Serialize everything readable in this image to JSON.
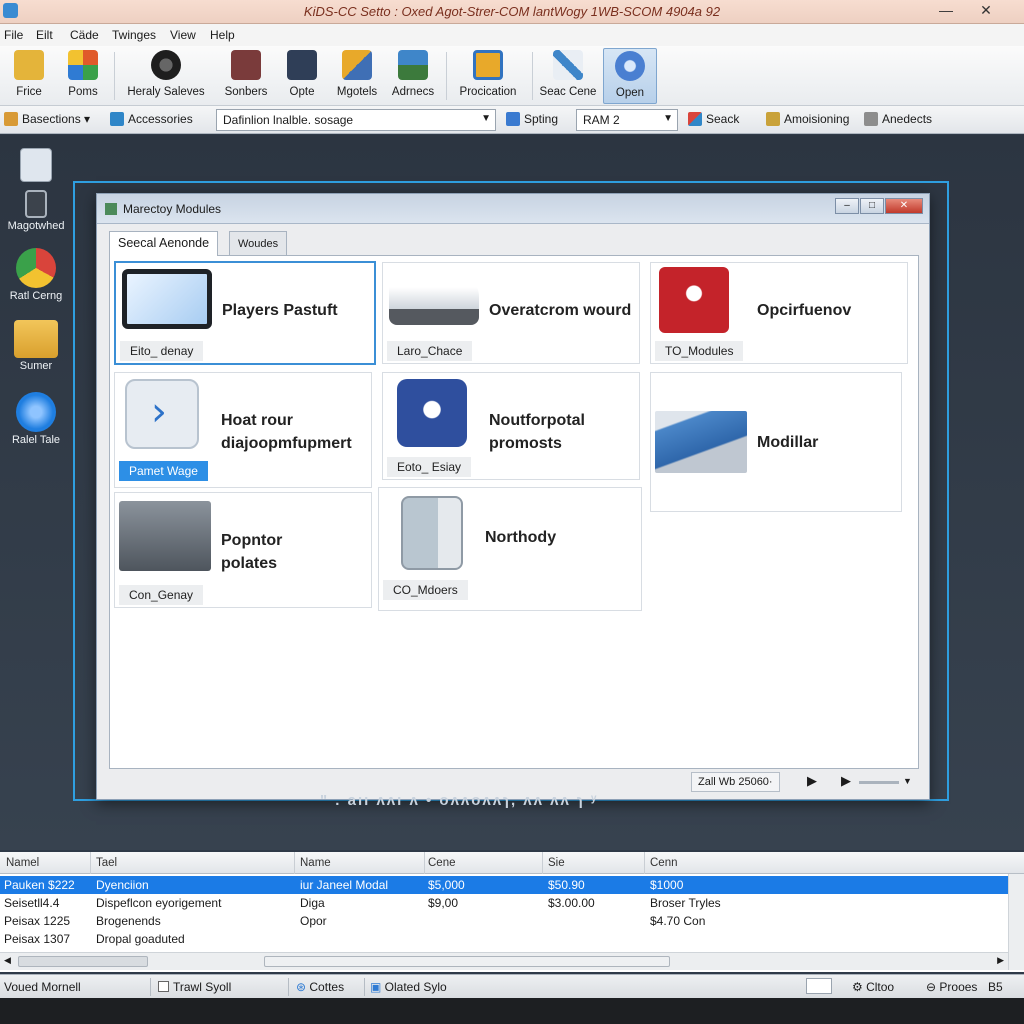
{
  "window": {
    "title": "KiDS-CC Setto : Oxed  Agot-Strer-COM  lantWogy  1WB-SCOM 4904a 92",
    "minimize": "—",
    "close": "✕"
  },
  "menu": [
    "File",
    "Eilt",
    "Cäde",
    "Twinges",
    "View",
    "Help"
  ],
  "ribbon": {
    "buttons": [
      {
        "label": "Frice",
        "icon": "folder-icon",
        "color": "#e4b43a"
      },
      {
        "label": "Poms",
        "icon": "color-palette-icon",
        "color": "#e05a2a"
      },
      {
        "label": "Heraly Saleves",
        "icon": "speaker-icon",
        "color": "#2b2b2b"
      },
      {
        "label": "Sonbers",
        "icon": "camera-icon",
        "color": "#7a3b3b"
      },
      {
        "label": "Opte",
        "icon": "monitor-icon",
        "color": "#2f3e57"
      },
      {
        "label": "Mgotels",
        "icon": "blocks-icon",
        "color": "#3f6fb5"
      },
      {
        "label": "Adrnecs",
        "icon": "gallery-icon",
        "color": "#3c7a3c"
      },
      {
        "label": "Procication",
        "icon": "document-icon",
        "color": "#e8a92a"
      },
      {
        "label": "Seac Cene",
        "icon": "search-pen-icon",
        "color": "#3f86c9"
      },
      {
        "label": "Open",
        "icon": "globe-icon",
        "color": "#4a7fd1"
      }
    ]
  },
  "toolbar2": {
    "basections": "Basections",
    "accessories": "Accessories",
    "path_combo": "Dafinlion lnalble. sosage",
    "spting": "Spting",
    "ram_combo": "RAM 2",
    "seack": "Seack",
    "amoisioning": "Amoisioning",
    "anedects": "Anedects"
  },
  "desktop": {
    "icons": [
      {
        "label": "",
        "icon": "document-window-icon",
        "color": "#dfe6ee"
      },
      {
        "label": "Magotwhed",
        "icon": "phone-icon",
        "color": "#3c434c"
      },
      {
        "label": "Ratl Cerng",
        "icon": "chrome-icon",
        "color": "#d9443b"
      },
      {
        "label": "Sumer",
        "icon": "folder-icon",
        "color": "#e9b43b"
      },
      {
        "label": "Ralel Tale",
        "icon": "bluetooth-icon",
        "color": "#1f7ee0"
      }
    ],
    "blurred_caption": "\" .  aıı ʌʌı ʌ • oʌʌoʌʌɿ,   ʌʌ  ʌʌ ɿ ʸ"
  },
  "dialog": {
    "title": "Marectoy Modules",
    "tabs": [
      "Seecal Aenonde",
      "Woudes"
    ],
    "cards": [
      {
        "name": "Players Pastuft",
        "sub": "Eito_ denay",
        "icon": "tablet-icon",
        "selected": true
      },
      {
        "name": "Overatcrom wourd",
        "sub": "Laro_Chace",
        "icon": "car-icon",
        "selected": false
      },
      {
        "name": "Opcirfuenov",
        "sub": "TO_Modules",
        "icon": "engine-badge-icon",
        "selected": false
      },
      {
        "name": "Hoat rour\ndiajoopmfupmert",
        "sub": "Pamet Wage",
        "icon": "chevron-chat-icon",
        "selected": false
      },
      {
        "name": "Noutforpotal\npromosts",
        "sub": "Eoto_ Esiay",
        "icon": "shield-lock-icon",
        "selected": false
      },
      {
        "name": "Modillar",
        "sub": "",
        "icon": "module-block-icon",
        "selected": false
      },
      {
        "name": "Popntor\npolates",
        "sub": "Con_Genay",
        "icon": "machine-icon",
        "selected": false
      },
      {
        "name": "Northody",
        "sub": "CO_Mdoers",
        "icon": "device-icon",
        "selected": false
      }
    ],
    "status_zoom": "Zall  Wb  25060·"
  },
  "list": {
    "columns": [
      "Namel",
      "Tael",
      "Name",
      "Cene",
      "Sie",
      "Cenn"
    ],
    "rows": [
      {
        "c1": "Pauken $222",
        "c2": "Dyenciion",
        "c3": "iur  Janeel Modal",
        "c4": "$5,000",
        "c5": "$50.90",
        "c6": "$1000",
        "selected": true
      },
      {
        "c1": "Seisetll4.4",
        "c2": "Dispeflcon eyorigement",
        "c3": "Diga",
        "c4": "$9,00",
        "c5": "$3.00.00",
        "c6": "Broser Tryles",
        "selected": false
      },
      {
        "c1": "Peisax 1225",
        "c2": "Brogenends",
        "c3": "Opor",
        "c4": "",
        "c5": "",
        "c6": "$4.70 Con",
        "selected": false
      },
      {
        "c1": "Peisax 1307",
        "c2": "Dropal goaduted",
        "c3": "",
        "c4": "",
        "c5": "",
        "c6": "",
        "selected": false
      }
    ]
  },
  "statusbar": {
    "left": "Voued Mornell",
    "trawl": "Trawl Syoll",
    "cottes": "Cottes",
    "olated": "Olated Sylo",
    "right1": "Cltoo",
    "right2": "Prooes",
    "right3": "B5"
  }
}
